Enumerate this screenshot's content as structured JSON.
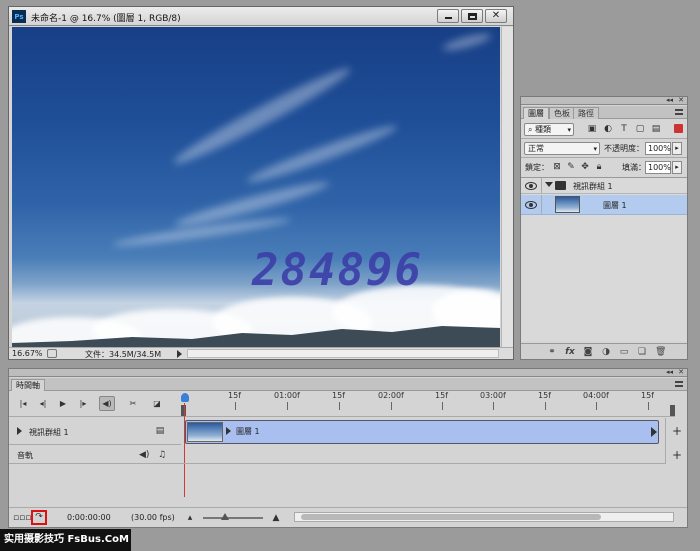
{
  "document": {
    "title": "未命名-1 @ 16.7% (圖層 1, RGB/8)",
    "app_icon": "Ps",
    "zoom": "16.67%",
    "doc_info": "文件：34.5M/34.5M",
    "watermark": "284896"
  },
  "layers_panel": {
    "tabs": [
      "圖層",
      "色板",
      "路徑"
    ],
    "active_tab": 0,
    "filter_kind": "種類",
    "blend_mode": "正常",
    "opacity_label": "不透明度：",
    "opacity_value": "100%",
    "lock_label": "鎖定：",
    "fill_label": "填滿：",
    "fill_value": "100%",
    "layers": [
      {
        "name": "視訊群組 1",
        "type": "group"
      },
      {
        "name": "圖層 1",
        "type": "layer",
        "selected": true
      }
    ],
    "footer_icons": [
      "link-icon",
      "fx-icon",
      "mask-icon",
      "adjustment-icon",
      "folder-icon",
      "new-layer-icon",
      "trash-icon"
    ]
  },
  "timeline": {
    "tab": "時間軸",
    "ruler_ticks": [
      "15f",
      "01:00f",
      "15f",
      "02:00f",
      "15f",
      "03:00f",
      "15f",
      "04:00f",
      "15f"
    ],
    "group_track": "視訊群組 1",
    "audio_track": "音軌",
    "clip_name": "圖層 1",
    "timecode": "0:00:00:00",
    "fps": "(30.00 fps)"
  },
  "banner": "实用摄影技巧 FsBus.CoM",
  "colors": {
    "selected_layer": "#b3cbef",
    "clip": "#a8bff0",
    "playhead": "#d23a3a",
    "render_highlight": "#dd1111"
  }
}
